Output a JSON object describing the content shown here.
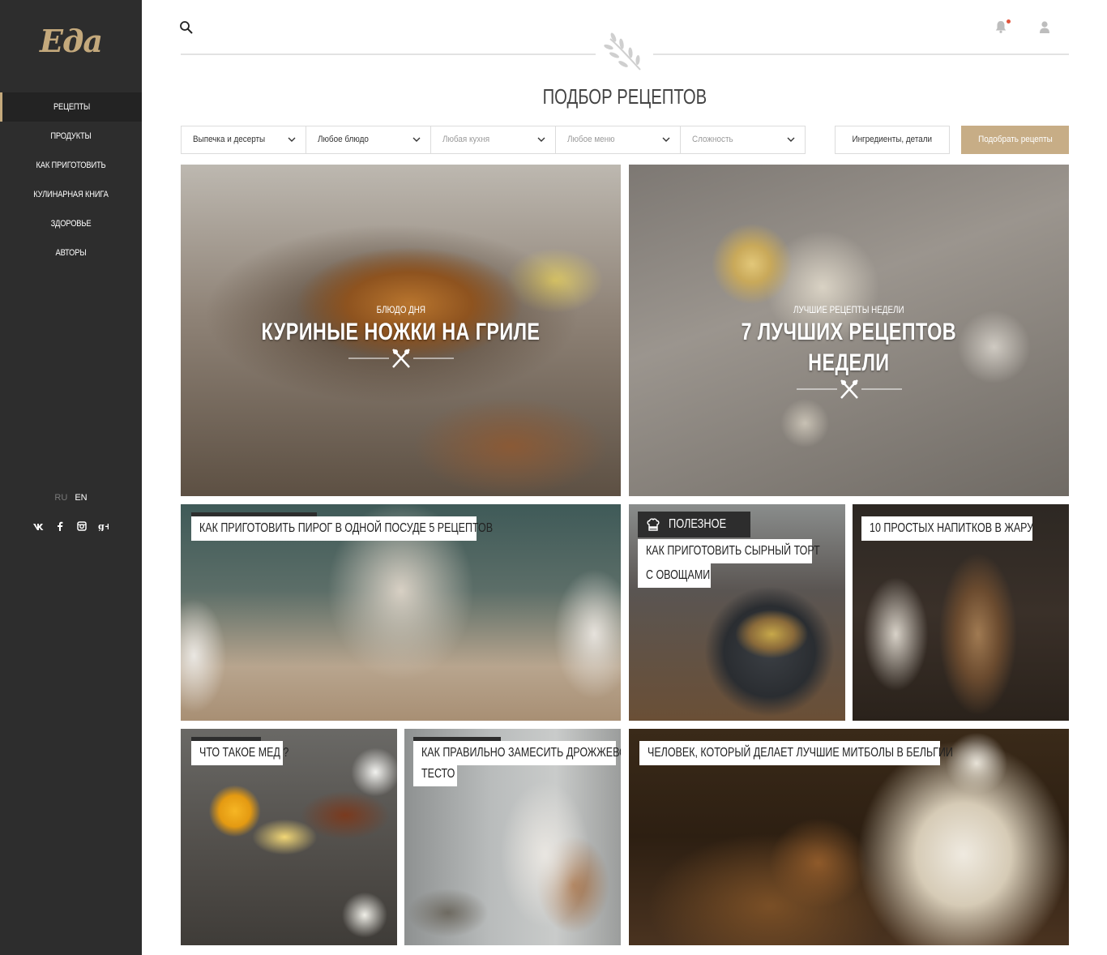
{
  "sidebar": {
    "logo": "Еда",
    "nav": [
      {
        "label": "РЕЦЕПТЫ",
        "active": true
      },
      {
        "label": "ПРОДУКТЫ",
        "active": false
      },
      {
        "label": "КАК ПРИГОТОВИТЬ",
        "active": false
      },
      {
        "label": "КУЛИНАРНАЯ КНИГА",
        "active": false
      },
      {
        "label": "ЗДОРОВЬЕ",
        "active": false
      },
      {
        "label": "АВТОРЫ",
        "active": false
      }
    ],
    "languages": {
      "inactive": "RU",
      "current": "EN"
    },
    "social": {
      "vk": "vk",
      "facebook": "f",
      "gplus": "g+"
    }
  },
  "header": {
    "title": "ПОДБОР РЕЦЕПТОВ",
    "notification_dot": true
  },
  "filters": {
    "category": "Выпечка и десерты",
    "dish": "Любое блюдо",
    "cuisine": "Любая кухня",
    "menu": "Любое меню",
    "difficulty": "Сложность",
    "ingredients": "Ингредиенты, детали",
    "submit_label": "Подобрать рецепты"
  },
  "cards": {
    "dish_of_day": {
      "subtitle": "БЛЮДО ДНЯ",
      "title": "КУРИНЫЕ НОЖКИ НА ГРИЛЕ"
    },
    "best_week": {
      "subtitle": "ЛУЧШИЕ РЕЦЕПТЫ НЕДЕЛИ",
      "title_line1": "7 ЛУЧШИХ РЕЦЕПТОВ",
      "title_line2": "НЕДЕЛИ"
    },
    "pie": {
      "title": "КАК ПРИГОТОВИТЬ ПИРОГ В ОДНОЙ ПОСУДЕ 5 РЕЦЕПТОВ"
    },
    "cheesecake": {
      "badge": "ПОЛЕЗНОЕ",
      "title_line1": "КАК ПРИГОТОВИТЬ СЫРНЫЙ ТОРТ",
      "title_line2": "С ОВОЩАМИ"
    },
    "drinks": {
      "title": "10 ПРОСТЫХ НАПИТКОВ В ЖАРУ"
    },
    "honey": {
      "title": "ЧТО ТАКОЕ МЕД ?"
    },
    "dough": {
      "title_line1": "КАК ПРАВИЛЬНО ЗАМЕСИТЬ ДРОЖЖЕВОЕ",
      "title_line2": "ТЕСТО"
    },
    "meatballs": {
      "title": "ЧЕЛОВЕК, КОТОРЫЙ ДЕЛАЕТ ЛУЧШИЕ МИТБОЛЫ В БЕЛЬГИИ"
    }
  },
  "colors": {
    "sidebar_bg": "#2d2d2d",
    "accent": "#c4a97c",
    "button": "#c7ad86",
    "notification": "#e2543b"
  }
}
